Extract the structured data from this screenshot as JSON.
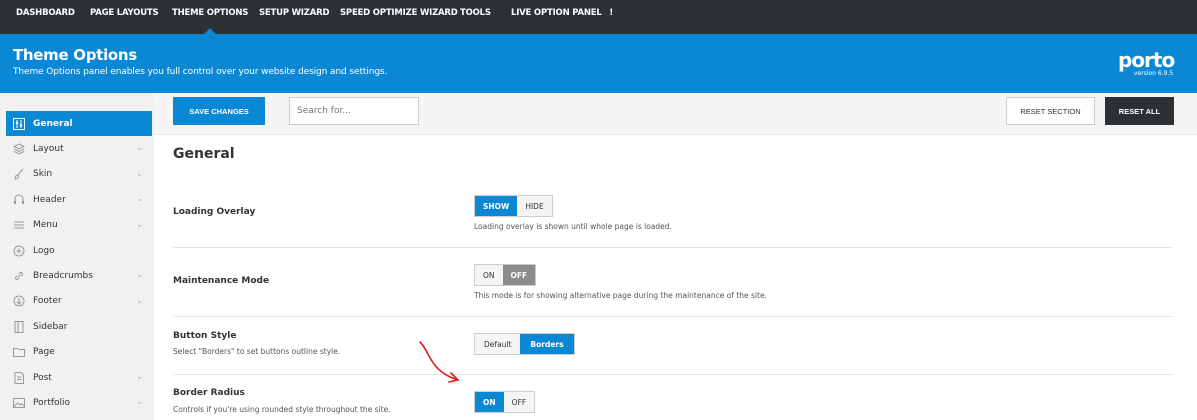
{
  "topnav": {
    "items": [
      {
        "label": "DASHBOARD"
      },
      {
        "label": "PAGE LAYOUTS"
      },
      {
        "label": "THEME OPTIONS"
      },
      {
        "label": "SETUP WIZARD"
      },
      {
        "label": "SPEED OPTIMIZE WIZARD"
      },
      {
        "label": "TOOLS"
      },
      {
        "label": "LIVE OPTION PANEL"
      }
    ],
    "live_badge": "!"
  },
  "header": {
    "title": "Theme Options",
    "subtitle": "Theme Options panel enables you full control over your website design and settings.",
    "logo": "porto",
    "version": "version 6.9.5"
  },
  "sidebar": {
    "items": [
      {
        "label": "General",
        "icon": "sliders-icon"
      },
      {
        "label": "Layout",
        "icon": "layers-icon"
      },
      {
        "label": "Skin",
        "icon": "brush-icon"
      },
      {
        "label": "Header",
        "icon": "header-icon"
      },
      {
        "label": "Menu",
        "icon": "menu-icon"
      },
      {
        "label": "Logo",
        "icon": "plus-circle-icon"
      },
      {
        "label": "Breadcrumbs",
        "icon": "link-icon"
      },
      {
        "label": "Footer",
        "icon": "arrow-down-circle-icon"
      },
      {
        "label": "Sidebar",
        "icon": "sidebar-icon"
      },
      {
        "label": "Page",
        "icon": "folder-icon"
      },
      {
        "label": "Post",
        "icon": "document-icon"
      },
      {
        "label": "Portfolio",
        "icon": "image-icon"
      }
    ]
  },
  "toolbar": {
    "save_label": "SAVE CHANGES",
    "search_placeholder": "Search for...",
    "reset_section_label": "RESET SECTION",
    "reset_all_label": "RESET ALL"
  },
  "main": {
    "section_title": "General",
    "rows": [
      {
        "label": "Loading Overlay",
        "options": [
          "SHOW",
          "HIDE"
        ],
        "selected": "SHOW",
        "help": "Loading overlay is shown until whole page is loaded."
      },
      {
        "label": "Maintenance Mode",
        "options": [
          "ON",
          "OFF"
        ],
        "selected": "OFF",
        "help": "This mode is for showing alternative page during the maintenance of the site."
      },
      {
        "label": "Button Style",
        "desc": "Select \"Borders\" to set buttons outline style.",
        "options": [
          "Default",
          "Borders"
        ],
        "selected": "Borders"
      },
      {
        "label": "Border Radius",
        "desc": "Controls if you're using rounded style throughout the site.",
        "options": [
          "ON",
          "OFF"
        ],
        "selected": "ON"
      }
    ]
  },
  "colors": {
    "accent": "#0b88d4",
    "nav_bg": "#2c2f33",
    "annotation_arrow": "#e02020"
  }
}
